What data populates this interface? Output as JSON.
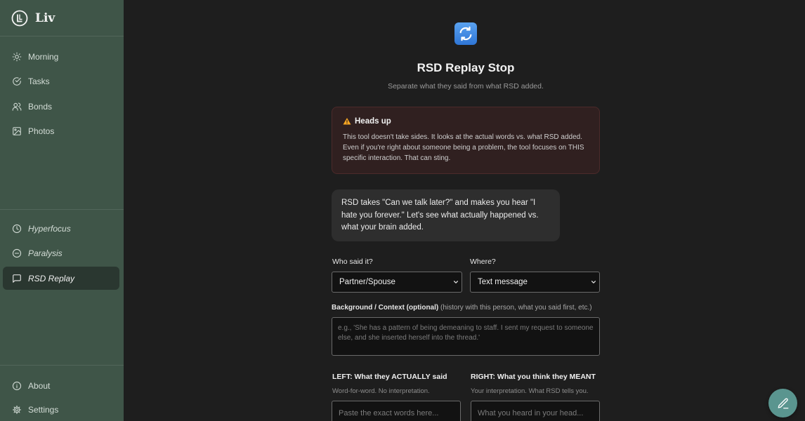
{
  "brand": {
    "name": "Liv",
    "logo_icon": "liv-logo-icon"
  },
  "sidebar": {
    "top_items": [
      {
        "label": "Morning",
        "icon": "sun-icon"
      },
      {
        "label": "Tasks",
        "icon": "check-circle-icon"
      },
      {
        "label": "Bonds",
        "icon": "users-icon"
      },
      {
        "label": "Photos",
        "icon": "image-icon"
      }
    ],
    "tool_items": [
      {
        "label": "Hyperfocus",
        "icon": "clock-icon"
      },
      {
        "label": "Paralysis",
        "icon": "minus-circle-icon"
      },
      {
        "label": "RSD Replay",
        "icon": "message-square-icon",
        "active": true
      }
    ],
    "bottom_items": [
      {
        "label": "About",
        "icon": "info-icon"
      },
      {
        "label": "Settings",
        "icon": "gear-icon"
      }
    ]
  },
  "page": {
    "icon": "repeat-arrows-icon",
    "title": "RSD Replay Stop",
    "subtitle": "Separate what they said from what RSD added."
  },
  "warning": {
    "title": "Heads up",
    "body": "This tool doesn't take sides. It looks at the actual words vs. what RSD added. Even if you're right about someone being a problem, the tool focuses on THIS specific interaction. That can sting."
  },
  "intro": {
    "text": "RSD takes \"Can we talk later?\" and makes you hear \"I hate you forever.\" Let's see what actually happened vs. what your brain added."
  },
  "form": {
    "who_label": "Who said it?",
    "who_value": "Partner/Spouse",
    "where_label": "Where?",
    "where_value": "Text message",
    "context_label": "Background / Context (optional)",
    "context_hint": "(history with this person, what you said first, etc.)",
    "context_placeholder": "e.g., 'She has a pattern of being demeaning to staff. I sent my request to someone else, and she inserted herself into the thread.'",
    "left_label": "LEFT: What they ACTUALLY said",
    "left_hint": "Word-for-word. No interpretation.",
    "left_placeholder": "Paste the exact words here...",
    "right_label": "RIGHT: What you think they MEANT",
    "right_hint": "Your interpretation. What RSD tells you.",
    "right_placeholder": "What you heard in your head..."
  },
  "fab": {
    "icon": "pencil-icon"
  },
  "colors": {
    "sidebar_bg": "#3f5548",
    "main_bg": "#1e1e1e",
    "warning_bg": "#302020",
    "accent_fab": "#5a958f",
    "icon_blue": "#3b87e0"
  }
}
